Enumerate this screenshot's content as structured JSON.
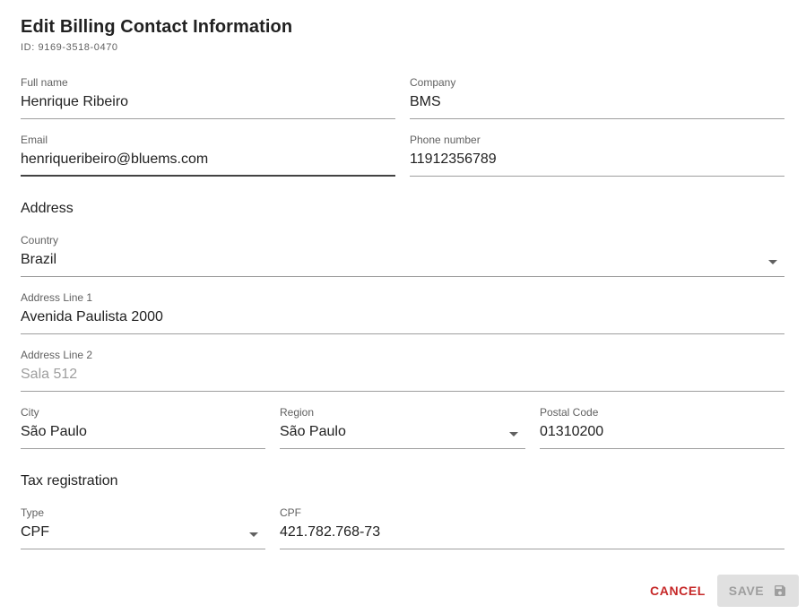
{
  "dialog": {
    "title": "Edit Billing Contact Information",
    "id_text": "ID: 9169-3518-0470"
  },
  "contact": {
    "full_name": {
      "label": "Full name",
      "value": "Henrique Ribeiro"
    },
    "company": {
      "label": "Company",
      "value": "BMS"
    },
    "email": {
      "label": "Email",
      "value": "henriqueribeiro@bluems.com"
    },
    "phone": {
      "label": "Phone number",
      "value": "11912356789"
    }
  },
  "address": {
    "heading": "Address",
    "country": {
      "label": "Country",
      "value": "Brazil"
    },
    "line1": {
      "label": "Address Line 1",
      "value": "Avenida Paulista 2000"
    },
    "line2": {
      "label": "Address Line 2",
      "placeholder": "Sala 512"
    },
    "city": {
      "label": "City",
      "value": "São Paulo"
    },
    "region": {
      "label": "Region",
      "value": "São Paulo"
    },
    "postal_code": {
      "label": "Postal Code",
      "value": "01310200"
    }
  },
  "tax": {
    "heading": "Tax registration",
    "type": {
      "label": "Type",
      "value": "CPF"
    },
    "number": {
      "label": "CPF",
      "value": "421.782.768-73"
    }
  },
  "actions": {
    "cancel_label": "CANCEL",
    "save_label": "SAVE",
    "save_icon": "floppy-disk-icon"
  },
  "colors": {
    "cancel": "#c62828",
    "save_disabled_bg": "#e0e0e0",
    "save_disabled_text": "#9e9e9e",
    "underline": "#9e9e9e",
    "focused_underline": "#424242"
  }
}
